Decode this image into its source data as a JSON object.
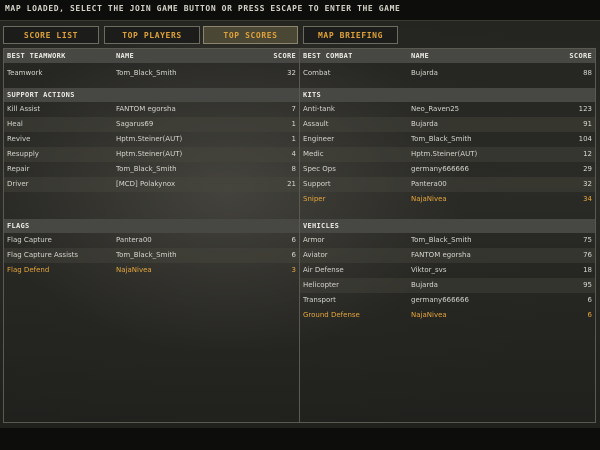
{
  "top_message": "MAP LOADED, SELECT THE JOIN GAME BUTTON OR PRESS ESCAPE TO ENTER THE GAME",
  "tabs": [
    {
      "label": "SCORE LIST"
    },
    {
      "label": "TOP PLAYERS"
    },
    {
      "label": "TOP SCORES"
    },
    {
      "label": "MAP BRIEFING"
    }
  ],
  "active_tab": "TOP SCORES",
  "colors": {
    "accent": "#e0a23a",
    "highlight_row": "#e6a63c",
    "header_bg": "#474743"
  },
  "sections": {
    "best_teamwork": {
      "title": "BEST TEAMWORK",
      "name_header": "NAME",
      "score_header": "SCORE",
      "rows": [
        {
          "category": "Teamwork",
          "name": "Tom_Black_Smith",
          "score": "32"
        }
      ]
    },
    "best_combat": {
      "title": "BEST COMBAT",
      "name_header": "NAME",
      "score_header": "SCORE",
      "rows": [
        {
          "category": "Combat",
          "name": "Bujarda",
          "score": "88"
        }
      ]
    },
    "support_actions": {
      "title": "SUPPORT ACTIONS",
      "rows": [
        {
          "category": "Kill Assist",
          "name": "FANTOM egorsha",
          "score": "7"
        },
        {
          "category": "Heal",
          "name": "Sagarus69",
          "score": "1"
        },
        {
          "category": "Revive",
          "name": "Hptm.Steiner(AUT)",
          "score": "1"
        },
        {
          "category": "Resupply",
          "name": "Hptm.Steiner(AUT)",
          "score": "4"
        },
        {
          "category": "Repair",
          "name": "Tom_Black_Smith",
          "score": "8"
        },
        {
          "category": "Driver",
          "name": "[MCD] Polakynox",
          "score": "21"
        }
      ]
    },
    "kits": {
      "title": "KITS",
      "rows": [
        {
          "category": "Anti-tank",
          "name": "Neo_Raven25",
          "score": "123"
        },
        {
          "category": "Assault",
          "name": "Bujarda",
          "score": "91"
        },
        {
          "category": "Engineer",
          "name": "Tom_Black_Smith",
          "score": "104"
        },
        {
          "category": "Medic",
          "name": "Hptm.Steiner(AUT)",
          "score": "12"
        },
        {
          "category": "Spec Ops",
          "name": "germany666666",
          "score": "29"
        },
        {
          "category": "Support",
          "name": "Pantera00",
          "score": "32"
        },
        {
          "category": "Sniper",
          "name": "NajaNivea",
          "score": "34"
        }
      ]
    },
    "flags": {
      "title": "FLAGS",
      "rows": [
        {
          "category": "Flag Capture",
          "name": "Pantera00",
          "score": "6"
        },
        {
          "category": "Flag Capture Assists",
          "name": "Tom_Black_Smith",
          "score": "6"
        },
        {
          "category": "Flag Defend",
          "name": "NajaNivea",
          "score": "3"
        }
      ]
    },
    "vehicles": {
      "title": "VEHICLES",
      "rows": [
        {
          "category": "Armor",
          "name": "Tom_Black_Smith",
          "score": "75"
        },
        {
          "category": "Aviator",
          "name": "FANTOM egorsha",
          "score": "76"
        },
        {
          "category": "Air Defense",
          "name": "Viktor_svs",
          "score": "18"
        },
        {
          "category": "Helicopter",
          "name": "Bujarda",
          "score": "95"
        },
        {
          "category": "Transport",
          "name": "germany666666",
          "score": "6"
        },
        {
          "category": "Ground Defense",
          "name": "NajaNivea",
          "score": "6"
        }
      ]
    }
  }
}
